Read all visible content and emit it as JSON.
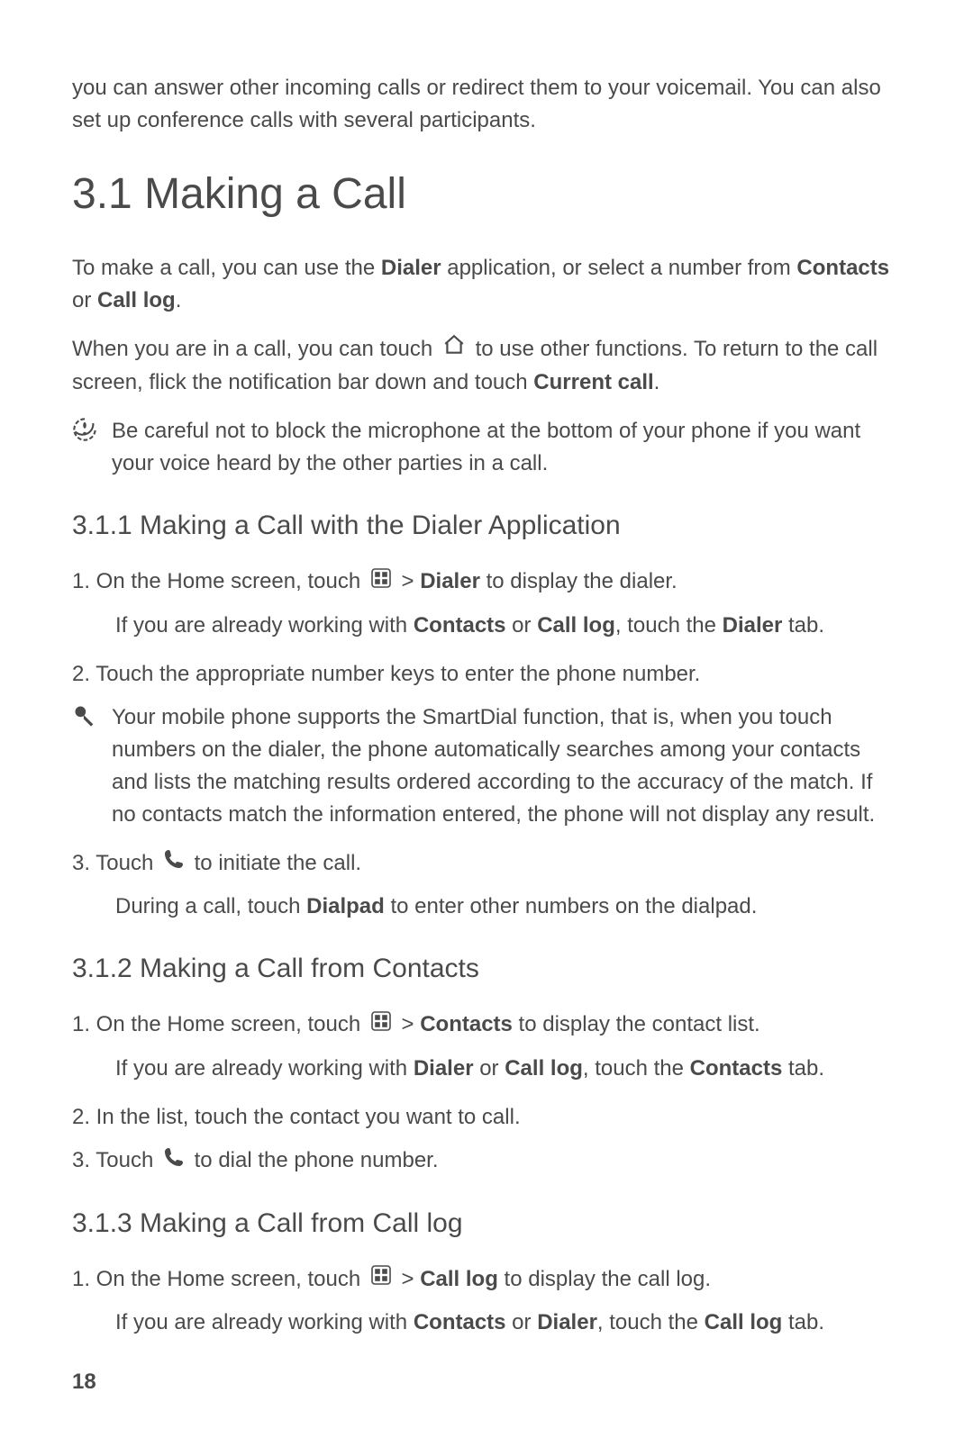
{
  "intro": "you can answer other incoming calls or redirect them to your voicemail. You can also set up conference calls with several participants.",
  "section_3_1": {
    "heading": "3.1  Making a Call",
    "para1_pre": "To make a call, you can use the ",
    "para1_b1": "Dialer",
    "para1_mid": " application, or select a number from ",
    "para1_b2": "Contacts",
    "para1_or": " or ",
    "para1_b3": "Call log",
    "para1_post": ".",
    "para2_pre": "When you are in a call, you can touch ",
    "para2_mid": " to use other functions. To return to the call screen, flick the notification bar down and touch ",
    "para2_b1": "Current call",
    "para2_post": ".",
    "note": "Be careful not to block the microphone at the bottom of your phone if you want your voice heard by the other parties in a call."
  },
  "section_3_1_1": {
    "heading": "3.1.1  Making a Call with the Dialer Application",
    "step1_pre": "1. On the Home screen, touch ",
    "step1_gt": " > ",
    "step1_b1": "Dialer",
    "step1_post": " to display the dialer.",
    "step1_sub_pre": "If you are already working with ",
    "step1_sub_b1": "Contacts",
    "step1_sub_or": " or ",
    "step1_sub_b2": "Call log",
    "step1_sub_mid": ", touch the ",
    "step1_sub_b3": "Dialer",
    "step1_sub_post": " tab.",
    "step2": "2. Touch the appropriate number keys to enter the phone number.",
    "tip": "Your mobile phone supports the SmartDial function, that is, when you touch numbers on the dialer, the phone automatically searches among your contacts and lists the matching results ordered according to the accuracy of the match. If no contacts match the information entered, the phone will not display any result.",
    "step3_pre": "3. Touch ",
    "step3_post": " to initiate the call.",
    "step3_sub_pre": "During a call, touch ",
    "step3_sub_b1": "Dialpad",
    "step3_sub_post": " to enter other numbers on the dialpad."
  },
  "section_3_1_2": {
    "heading": "3.1.2  Making a Call from Contacts",
    "step1_pre": "1. On the Home screen, touch ",
    "step1_gt": " > ",
    "step1_b1": "Contacts",
    "step1_post": " to display the contact list.",
    "step1_sub_pre": "If you are already working with ",
    "step1_sub_b1": "Dialer",
    "step1_sub_or": " or ",
    "step1_sub_b2": "Call log",
    "step1_sub_mid": ", touch the ",
    "step1_sub_b3": "Contacts",
    "step1_sub_post": " tab.",
    "step2": "2. In the list, touch the contact you want to call.",
    "step3_pre": "3. Touch ",
    "step3_post": " to dial the phone number."
  },
  "section_3_1_3": {
    "heading": "3.1.3  Making a Call from Call log",
    "step1_pre": "1. On the Home screen, touch ",
    "step1_gt": " > ",
    "step1_b1": "Call log",
    "step1_post": " to display the call log.",
    "step1_sub_pre": "If you are already working with ",
    "step1_sub_b1": "Contacts",
    "step1_sub_or": " or ",
    "step1_sub_b2": "Dialer",
    "step1_sub_mid": ", touch the ",
    "step1_sub_b3": "Call log",
    "step1_sub_post": " tab."
  },
  "page_number": "18"
}
